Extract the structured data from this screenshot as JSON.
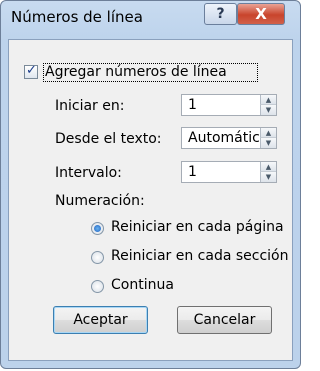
{
  "window": {
    "title": "Números de línea",
    "help_glyph": "?",
    "close_glyph": "X"
  },
  "options": {
    "add_numbers": {
      "label": "Agregar números de línea",
      "checked": true
    },
    "start_at": {
      "label": "Iniciar en:",
      "value": "1"
    },
    "from_text": {
      "label": "Desde el texto:",
      "value": "Automático"
    },
    "interval": {
      "label": "Intervalo:",
      "value": "1"
    }
  },
  "numbering": {
    "label": "Numeración:",
    "options": [
      {
        "label": "Reiniciar en cada página",
        "selected": true
      },
      {
        "label": "Reiniciar en cada sección",
        "selected": false
      },
      {
        "label": "Continua",
        "selected": false
      }
    ]
  },
  "buttons": {
    "ok": "Aceptar",
    "cancel": "Cancelar"
  }
}
